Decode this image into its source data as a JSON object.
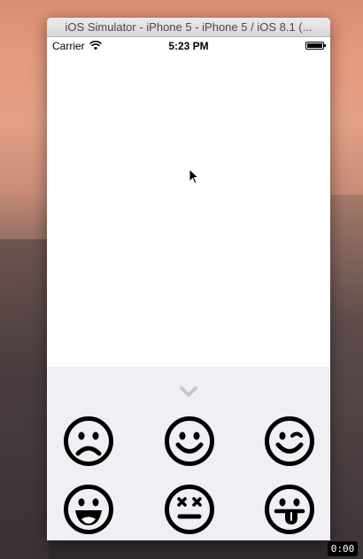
{
  "simulator": {
    "title": "iOS Simulator - iPhone 5 - iPhone 5 / iOS 8.1 (..."
  },
  "statusbar": {
    "carrier": "Carrier",
    "time": "5:23 PM",
    "wifi_icon": "wifi-icon",
    "battery_icon": "battery-icon"
  },
  "emoji_panel": {
    "collapse_icon": "chevron-down-icon",
    "emojis": [
      {
        "name": "frowning-face-icon"
      },
      {
        "name": "smiling-face-icon"
      },
      {
        "name": "winking-face-icon"
      },
      {
        "name": "grinning-face-icon"
      },
      {
        "name": "dizzy-face-icon"
      },
      {
        "name": "tongue-out-face-icon"
      }
    ]
  },
  "recorder": {
    "counter": "0:00"
  }
}
